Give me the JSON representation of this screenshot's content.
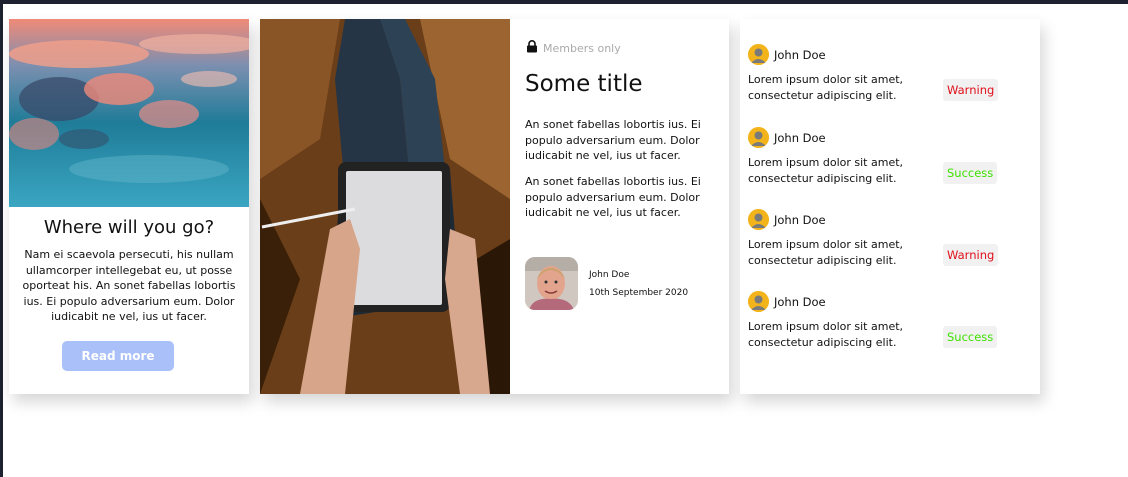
{
  "travel_card": {
    "title": "Where will you go?",
    "text": "Nam ei scaevola persecuti, his nullam ullamcorper intellegebat eu, ut posse oporteat his. An sonet fabellas lobortis ius. Ei populo adversarium eum. Dolor iudicabit ne vel, ius ut facer.",
    "button_label": "Read more",
    "button_color": "#aac0f9"
  },
  "article_card": {
    "badge": "Members only",
    "title": "Some title",
    "paragraphs": [
      "An sonet fabellas lobortis ius. Ei populo adversarium eum. Dolor iudicabit ne vel, ius ut facer.",
      "An sonet fabellas lobortis ius. Ei populo adversarium eum. Dolor iudicabit ne vel, ius ut facer."
    ],
    "author": {
      "name": "John Doe",
      "date": "10th September 2020"
    }
  },
  "feed": {
    "items": [
      {
        "name": "John Doe",
        "text": "Lorem ipsum dolor sit amet, consectetur adipiscing elit.",
        "status": "Warning",
        "status_color": "#e0101a"
      },
      {
        "name": "John Doe",
        "text": "Lorem ipsum dolor sit amet, consectetur adipiscing elit.",
        "status": "Success",
        "status_color": "#3ee000"
      },
      {
        "name": "John Doe",
        "text": "Lorem ipsum dolor sit amet, consectetur adipiscing elit.",
        "status": "Warning",
        "status_color": "#e0101a"
      },
      {
        "name": "John Doe",
        "text": "Lorem ipsum dolor sit amet, consectetur adipiscing elit.",
        "status": "Success",
        "status_color": "#3ee000"
      }
    ]
  }
}
